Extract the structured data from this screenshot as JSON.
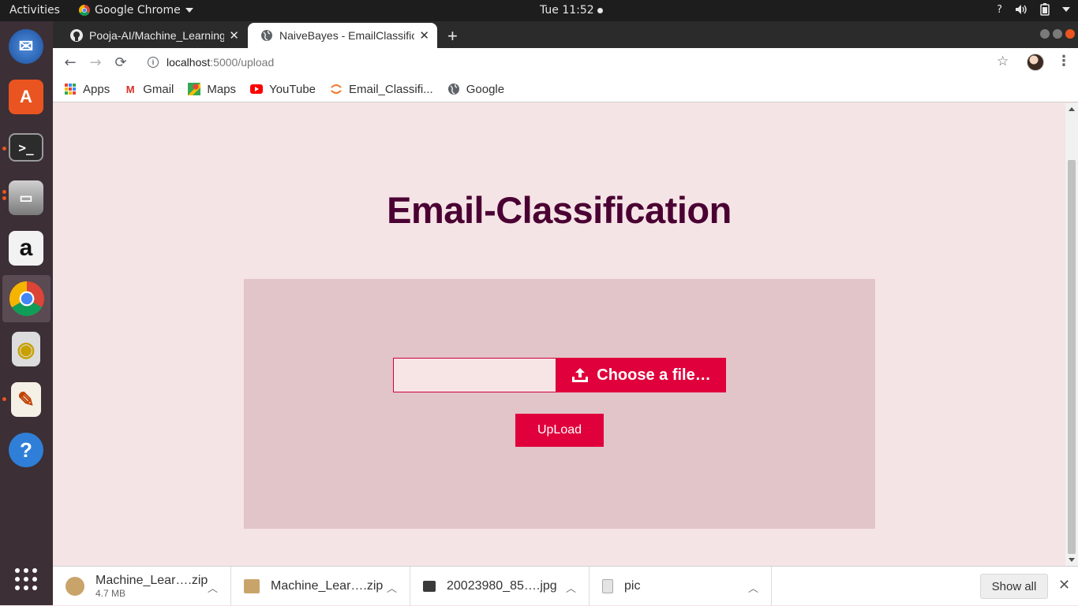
{
  "system": {
    "activities": "Activities",
    "app_name": "Google Chrome",
    "clock": "Tue 11:52",
    "help": "?"
  },
  "dock": {
    "items": [
      {
        "name": "thunderbird-icon",
        "color": "#2a6bc4",
        "glyph": "✉"
      },
      {
        "name": "software-center-icon",
        "color": "#e95420",
        "glyph": "A"
      },
      {
        "name": "terminal-icon",
        "color": "#2c2c2c",
        "glyph": ">_"
      },
      {
        "name": "files-icon",
        "color": "#8a8a8a",
        "glyph": "▭"
      },
      {
        "name": "amazon-icon",
        "color": "#f2f2f2",
        "glyph": "a"
      },
      {
        "name": "chrome-icon",
        "color": "#ffffff",
        "glyph": ""
      },
      {
        "name": "rhythmbox-icon",
        "color": "#dcdcdc",
        "glyph": "◉"
      },
      {
        "name": "text-editor-icon",
        "color": "#f4f0e6",
        "glyph": "✎"
      },
      {
        "name": "help-icon",
        "color": "#2f7fd8",
        "glyph": "?"
      },
      {
        "name": "show-apps-icon",
        "color": "#3c2f36",
        "glyph": "⋮⋮⋮"
      }
    ]
  },
  "browser": {
    "tabs": [
      {
        "title": "Pooja-AI/Machine_Learning",
        "active": false
      },
      {
        "title": "NaiveBayes - EmailClassification",
        "active": true
      }
    ],
    "url_host": "localhost",
    "url_path": ":5000/upload",
    "bookmarks": [
      {
        "label": "Apps"
      },
      {
        "label": "Gmail"
      },
      {
        "label": "Maps"
      },
      {
        "label": "YouTube"
      },
      {
        "label": "Email_Classifi..."
      },
      {
        "label": "Google"
      }
    ]
  },
  "page": {
    "title": "Email-Classification",
    "choose_file_label": "Choose a file…",
    "upload_label": "UpLoad"
  },
  "downloads": {
    "items": [
      {
        "name": "Machine_Lear….zip",
        "size": "4.7 MB"
      },
      {
        "name": "Machine_Lear….zip",
        "size": ""
      },
      {
        "name": "20023980_85….jpg",
        "size": ""
      },
      {
        "name": "pic",
        "size": ""
      }
    ],
    "show_all": "Show all"
  },
  "colors": {
    "accent": "#e0003c",
    "title": "#4a0033",
    "page_bg": "#f5e4e5",
    "card_bg": "#e2c5c9"
  }
}
